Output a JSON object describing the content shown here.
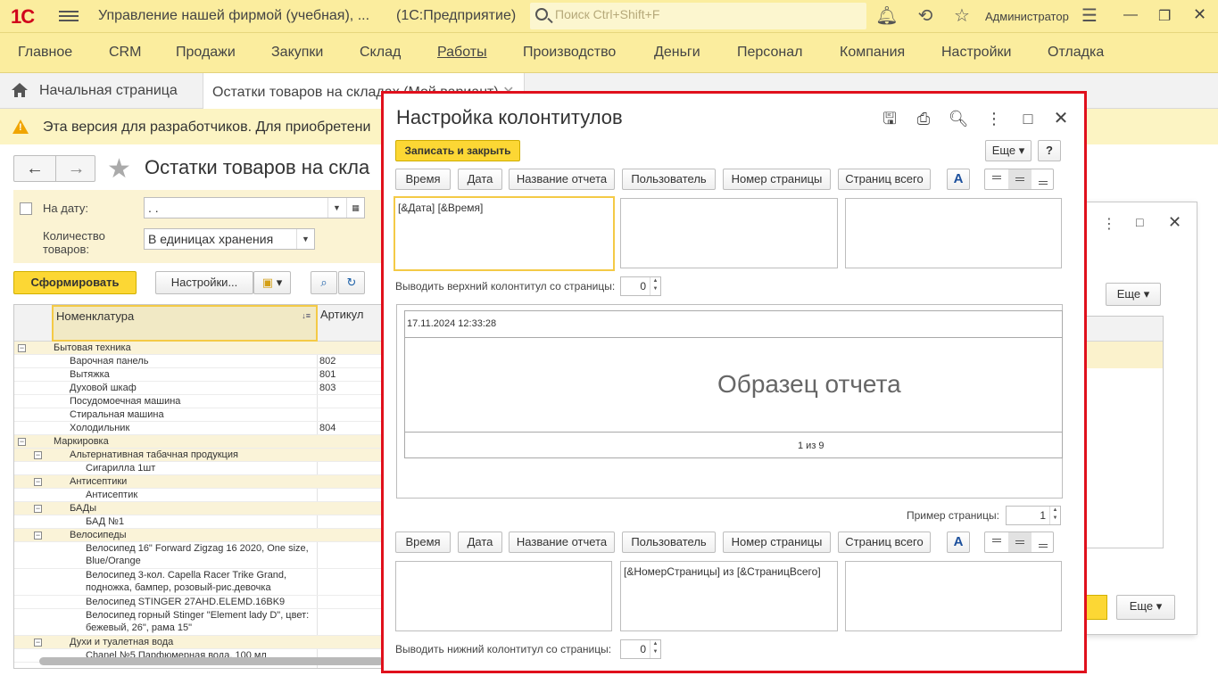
{
  "app": {
    "title": "Управление нашей фирмой (учебная), ...",
    "platform": "(1С:Предприятие)",
    "logo_text": "1С",
    "search_placeholder": "Поиск Ctrl+Shift+F",
    "user": "Администратор"
  },
  "menu": [
    "Главное",
    "CRM",
    "Продажи",
    "Закупки",
    "Склад",
    "Работы",
    "Производство",
    "Деньги",
    "Персонал",
    "Компания",
    "Настройки",
    "Отладка"
  ],
  "tabs": {
    "home": "Начальная страница",
    "current": "Остатки товаров на складах (Мой вариант)"
  },
  "warning": "Эта версия для разработчиков. Для приобретени",
  "report": {
    "title": "Остатки товаров на скла",
    "date_label": "На дату:",
    "date_value": " .  .",
    "qty_label_1": "Количество",
    "qty_label_2": "товаров:",
    "qty_value": "В единицах хранения",
    "generate_btn": "Сформировать",
    "settings_btn": "Настройки...",
    "col_name": "Номенклатура",
    "col_article": "Артикул",
    "rows": [
      {
        "name": "Бытовая техника",
        "art": "",
        "level": 0,
        "group": true
      },
      {
        "name": "Варочная панель",
        "art": "802",
        "level": 1,
        "group": false
      },
      {
        "name": "Вытяжка",
        "art": "801",
        "level": 1,
        "group": false
      },
      {
        "name": "Духовой шкаф",
        "art": "803",
        "level": 1,
        "group": false
      },
      {
        "name": "Посудомоечная машина",
        "art": "",
        "level": 1,
        "group": false
      },
      {
        "name": "Стиральная машина",
        "art": "",
        "level": 1,
        "group": false
      },
      {
        "name": "Холодильник",
        "art": "804",
        "level": 1,
        "group": false
      },
      {
        "name": "Маркировка",
        "art": "",
        "level": 0,
        "group": true
      },
      {
        "name": "Альтернативная табачная продукция",
        "art": "",
        "level": 1,
        "group": true
      },
      {
        "name": "Сигарилла 1шт",
        "art": "",
        "level": 2,
        "group": false
      },
      {
        "name": "Антисептики",
        "art": "",
        "level": 1,
        "group": true
      },
      {
        "name": "Антисептик",
        "art": "",
        "level": 2,
        "group": false
      },
      {
        "name": "БАДы",
        "art": "",
        "level": 1,
        "group": true
      },
      {
        "name": "БАД №1",
        "art": "",
        "level": 2,
        "group": false
      },
      {
        "name": "Велосипеды",
        "art": "",
        "level": 1,
        "group": true
      },
      {
        "name": "Велосипед 16\" Forward Zigzag 16 2020, One size,\nBlue/Orange",
        "art": "",
        "level": 2,
        "group": false
      },
      {
        "name": "Велосипед 3-кол. Capella Racer Trike Grand,\nподножка, бампер, розовый-рис.девочка",
        "art": "",
        "level": 2,
        "group": false
      },
      {
        "name": "Велосипед STINGER 27AHD.ELEMD.16BK9",
        "art": "",
        "level": 2,
        "group": false
      },
      {
        "name": "Велосипед горный Stinger \"Element lady D\", цвет:\nбежевый, 26\", рама 15\"",
        "art": "",
        "level": 2,
        "group": false
      },
      {
        "name": "Духи и туалетная вода",
        "art": "",
        "level": 1,
        "group": true
      },
      {
        "name": "Chanel №5 Парфюмерная вода, 100 мл",
        "art": "",
        "level": 2,
        "group": false
      }
    ]
  },
  "bg_dialog": {
    "more_btn": "Еще",
    "more_btn2": "Еще"
  },
  "modal": {
    "title": "Настройка колонтитулов",
    "save_close": "Записать и закрыть",
    "more": "Еще",
    "help": "?",
    "header_buttons": [
      "Время",
      "Дата",
      "Название отчета",
      "Пользователь",
      "Номер страницы",
      "Страниц всего"
    ],
    "font_btn": "A",
    "header_left": "[&Дата]  [&Время]",
    "header_center": "",
    "header_right": "",
    "header_from_label": "Выводить верхний колонтитул со страницы:",
    "header_from_value": "0",
    "preview_header": "17.11.2024  12:33:28",
    "preview_sample": "Образец отчета",
    "preview_footer": "1 из 9",
    "sample_page_label": "Пример страницы:",
    "sample_page_value": "1",
    "footer_left": "",
    "footer_center": "[&НомерСтраницы] из [&СтраницВсего]",
    "footer_right": "",
    "footer_from_label": "Выводить нижний колонтитул со страницы:",
    "footer_from_value": "0"
  },
  "colors": {
    "accent_yellow": "#fcd734",
    "top_bar": "#fbed9e",
    "modal_border": "#e0101c"
  }
}
